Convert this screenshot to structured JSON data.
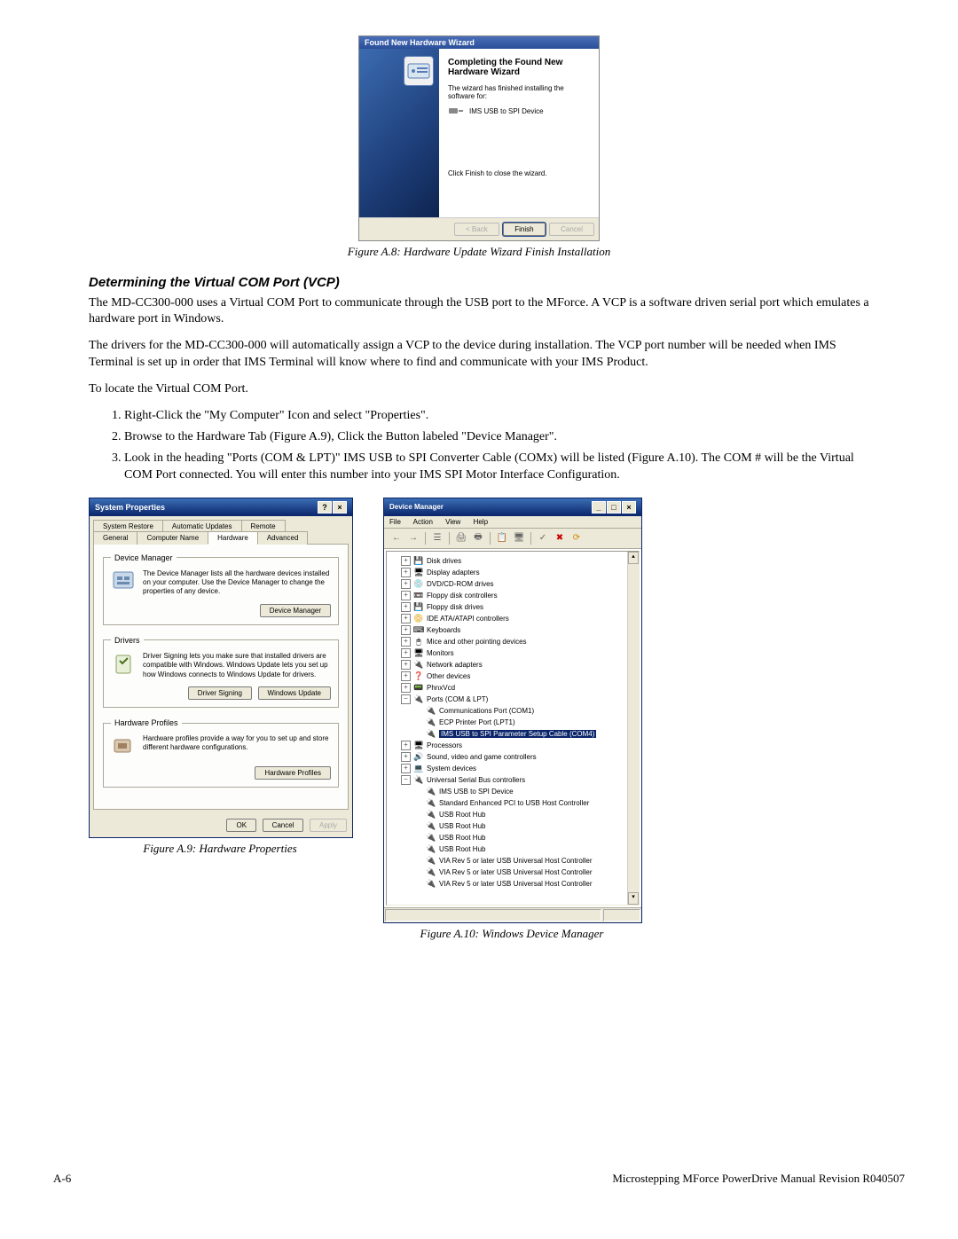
{
  "wizard": {
    "title": "Found New Hardware Wizard",
    "heading": "Completing the Found New Hardware Wizard",
    "subtext": "The wizard has finished installing the software for:",
    "device": "IMS USB to SPI Device",
    "click_text": "Click Finish to close the wizard.",
    "back": "< Back",
    "finish": "Finish",
    "cancel": "Cancel"
  },
  "caption_a8": "Figure A.8: Hardware Update Wizard Finish Installation",
  "section_heading": "Determining the Virtual COM Port (VCP)",
  "para1": "The MD-CC300-000 uses a Virtual COM Port to communicate through the USB port to the MForce. A VCP is a software driven serial port which emulates a hardware port in Windows.",
  "para2": "The drivers for the MD-CC300-000 will automatically assign a VCP to the device during installation. The VCP port number will be needed when IMS Terminal is set up in order that IMS Terminal will know where to find and communicate with your IMS Product.",
  "para3": "To locate the Virtual COM Port.",
  "steps": [
    "Right-Click the \"My Computer\" Icon and select \"Properties\".",
    "Browse to the Hardware Tab (Figure A.9), Click the Button labeled \"Device Manager\".",
    "Look in the heading \"Ports (COM & LPT)\" IMS USB to SPI Converter Cable (COMx) will be listed (Figure A.10). The COM # will be the Virtual COM Port connected. You will enter this number into your IMS SPI Motor Interface Configuration."
  ],
  "sysprops": {
    "title": "System Properties",
    "tabs_row1": [
      "System Restore",
      "Automatic Updates",
      "Remote"
    ],
    "tabs_row2": [
      "General",
      "Computer Name",
      "Hardware",
      "Advanced"
    ],
    "active_tab": "Hardware",
    "devmgr_legend": "Device Manager",
    "devmgr_text": "The Device Manager lists all the hardware devices installed on your computer. Use the Device Manager to change the properties of any device.",
    "devmgr_btn": "Device Manager",
    "drivers_legend": "Drivers",
    "drivers_text": "Driver Signing lets you make sure that installed drivers are compatible with Windows. Windows Update lets you set up how Windows connects to Windows Update for drivers.",
    "drivers_btn1": "Driver Signing",
    "drivers_btn2": "Windows Update",
    "hwprof_legend": "Hardware Profiles",
    "hwprof_text": "Hardware profiles provide a way for you to set up and store different hardware configurations.",
    "hwprof_btn": "Hardware Profiles",
    "ok": "OK",
    "cancel": "Cancel",
    "apply": "Apply"
  },
  "caption_a9": "Figure A.9: Hardware Properties",
  "devmgr": {
    "title": "Device Manager",
    "menu": [
      "File",
      "Action",
      "View",
      "Help"
    ],
    "tree": [
      {
        "depth": 1,
        "exp": "+",
        "icon": "💾",
        "label": "Disk drives",
        "sel": false
      },
      {
        "depth": 1,
        "exp": "+",
        "icon": "🖥",
        "label": "Display adapters",
        "sel": false
      },
      {
        "depth": 1,
        "exp": "+",
        "icon": "💿",
        "label": "DVD/CD-ROM drives",
        "sel": false
      },
      {
        "depth": 1,
        "exp": "+",
        "icon": "📼",
        "label": "Floppy disk controllers",
        "sel": false
      },
      {
        "depth": 1,
        "exp": "+",
        "icon": "💾",
        "label": "Floppy disk drives",
        "sel": false
      },
      {
        "depth": 1,
        "exp": "+",
        "icon": "📀",
        "label": "IDE ATA/ATAPI controllers",
        "sel": false
      },
      {
        "depth": 1,
        "exp": "+",
        "icon": "⌨",
        "label": "Keyboards",
        "sel": false
      },
      {
        "depth": 1,
        "exp": "+",
        "icon": "🖱",
        "label": "Mice and other pointing devices",
        "sel": false
      },
      {
        "depth": 1,
        "exp": "+",
        "icon": "🖥",
        "label": "Monitors",
        "sel": false
      },
      {
        "depth": 1,
        "exp": "+",
        "icon": "🔌",
        "label": "Network adapters",
        "sel": false
      },
      {
        "depth": 1,
        "exp": "+",
        "icon": "❓",
        "label": "Other devices",
        "sel": false
      },
      {
        "depth": 1,
        "exp": "+",
        "icon": "📟",
        "label": "PhnxVcd",
        "sel": false
      },
      {
        "depth": 1,
        "exp": "−",
        "icon": "🔌",
        "label": "Ports (COM & LPT)",
        "sel": false
      },
      {
        "depth": 2,
        "exp": "",
        "icon": "🔌",
        "label": "Communications Port (COM1)",
        "sel": false
      },
      {
        "depth": 2,
        "exp": "",
        "icon": "🔌",
        "label": "ECP Printer Port (LPT1)",
        "sel": false
      },
      {
        "depth": 2,
        "exp": "",
        "icon": "🔌",
        "label": "IMS USB to SPI Parameter Setup Cable (COM4)",
        "sel": true
      },
      {
        "depth": 1,
        "exp": "+",
        "icon": "🖥",
        "label": "Processors",
        "sel": false
      },
      {
        "depth": 1,
        "exp": "+",
        "icon": "🔊",
        "label": "Sound, video and game controllers",
        "sel": false
      },
      {
        "depth": 1,
        "exp": "+",
        "icon": "💻",
        "label": "System devices",
        "sel": false
      },
      {
        "depth": 1,
        "exp": "−",
        "icon": "🔌",
        "label": "Universal Serial Bus controllers",
        "sel": false
      },
      {
        "depth": 2,
        "exp": "",
        "icon": "🔌",
        "label": "IMS USB to SPI Device",
        "sel": false
      },
      {
        "depth": 2,
        "exp": "",
        "icon": "🔌",
        "label": "Standard Enhanced PCI to USB Host Controller",
        "sel": false
      },
      {
        "depth": 2,
        "exp": "",
        "icon": "🔌",
        "label": "USB Root Hub",
        "sel": false
      },
      {
        "depth": 2,
        "exp": "",
        "icon": "🔌",
        "label": "USB Root Hub",
        "sel": false
      },
      {
        "depth": 2,
        "exp": "",
        "icon": "🔌",
        "label": "USB Root Hub",
        "sel": false
      },
      {
        "depth": 2,
        "exp": "",
        "icon": "🔌",
        "label": "USB Root Hub",
        "sel": false
      },
      {
        "depth": 2,
        "exp": "",
        "icon": "🔌",
        "label": "VIA Rev 5 or later USB Universal Host Controller",
        "sel": false
      },
      {
        "depth": 2,
        "exp": "",
        "icon": "🔌",
        "label": "VIA Rev 5 or later USB Universal Host Controller",
        "sel": false
      },
      {
        "depth": 2,
        "exp": "",
        "icon": "🔌",
        "label": "VIA Rev 5 or later USB Universal Host Controller",
        "sel": false
      }
    ]
  },
  "caption_a10": "Figure A.10: Windows Device Manager",
  "footer_left": "A-6",
  "footer_right": "Microstepping MForce PowerDrive Manual Revision R040507"
}
